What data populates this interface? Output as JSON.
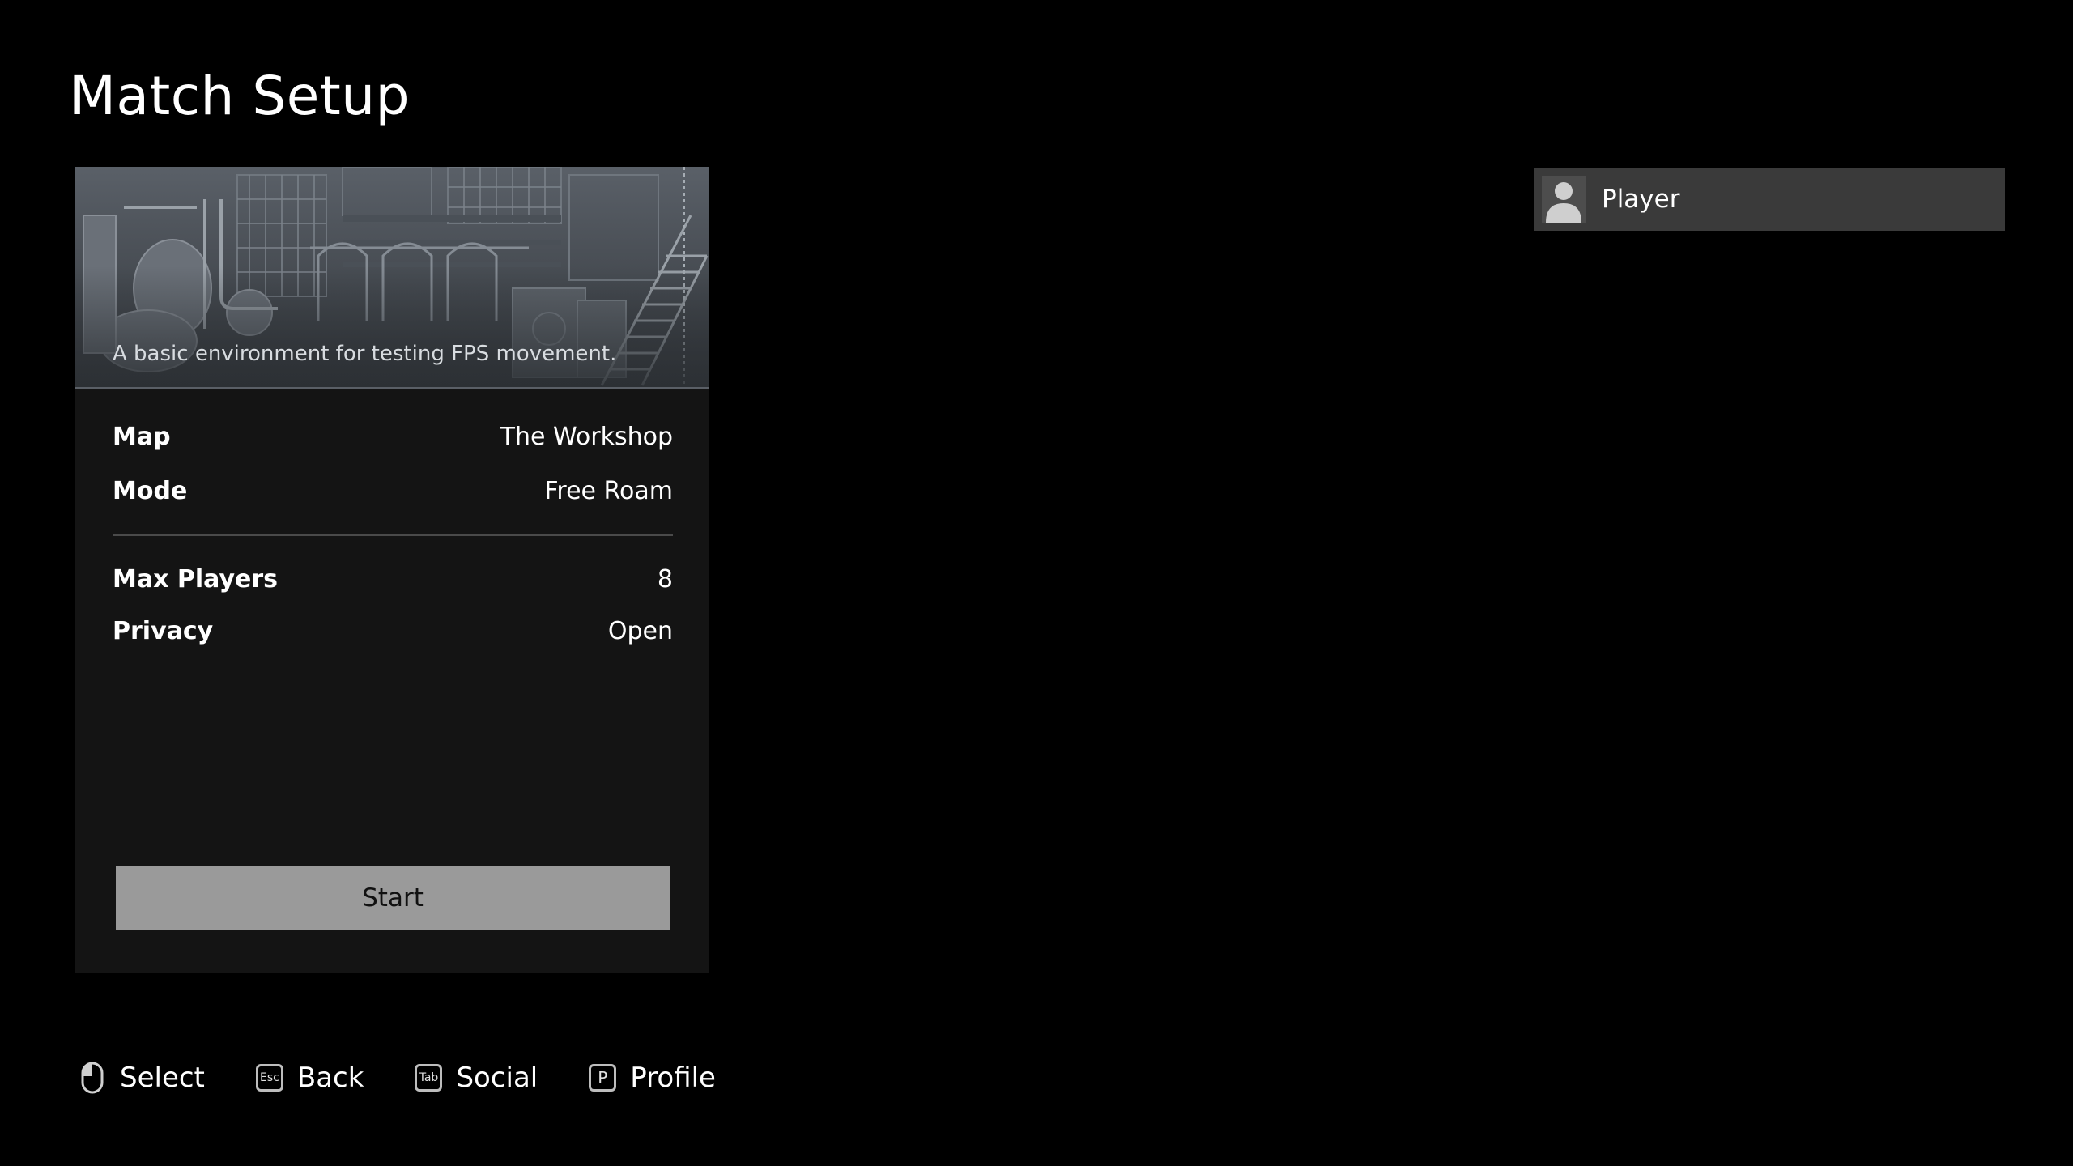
{
  "page": {
    "title": "Match Setup"
  },
  "map": {
    "description": "A basic environment for testing FPS movement."
  },
  "settings": [
    {
      "label": "Map",
      "value": "The Workshop"
    },
    {
      "label": "Mode",
      "value": "Free Roam"
    },
    {
      "label": "Max Players",
      "value": "8"
    },
    {
      "label": "Privacy",
      "value": "Open"
    }
  ],
  "start_button": {
    "label": "Start"
  },
  "player": {
    "name": "Player",
    "avatar_icon": "user-silhouette-icon"
  },
  "hints": [
    {
      "icon": "mouse-icon",
      "key": "",
      "label": "Select"
    },
    {
      "icon": "esc-key-icon",
      "key": "Esc",
      "label": "Back"
    },
    {
      "icon": "tab-key-icon",
      "key": "Tab",
      "label": "Social"
    },
    {
      "icon": "p-key-icon",
      "key": "P",
      "label": "Profile"
    }
  ],
  "colors": {
    "background": "#000000",
    "panel": "#141414",
    "button": "#9a9a9a",
    "player_card": "#3a3a3a"
  }
}
